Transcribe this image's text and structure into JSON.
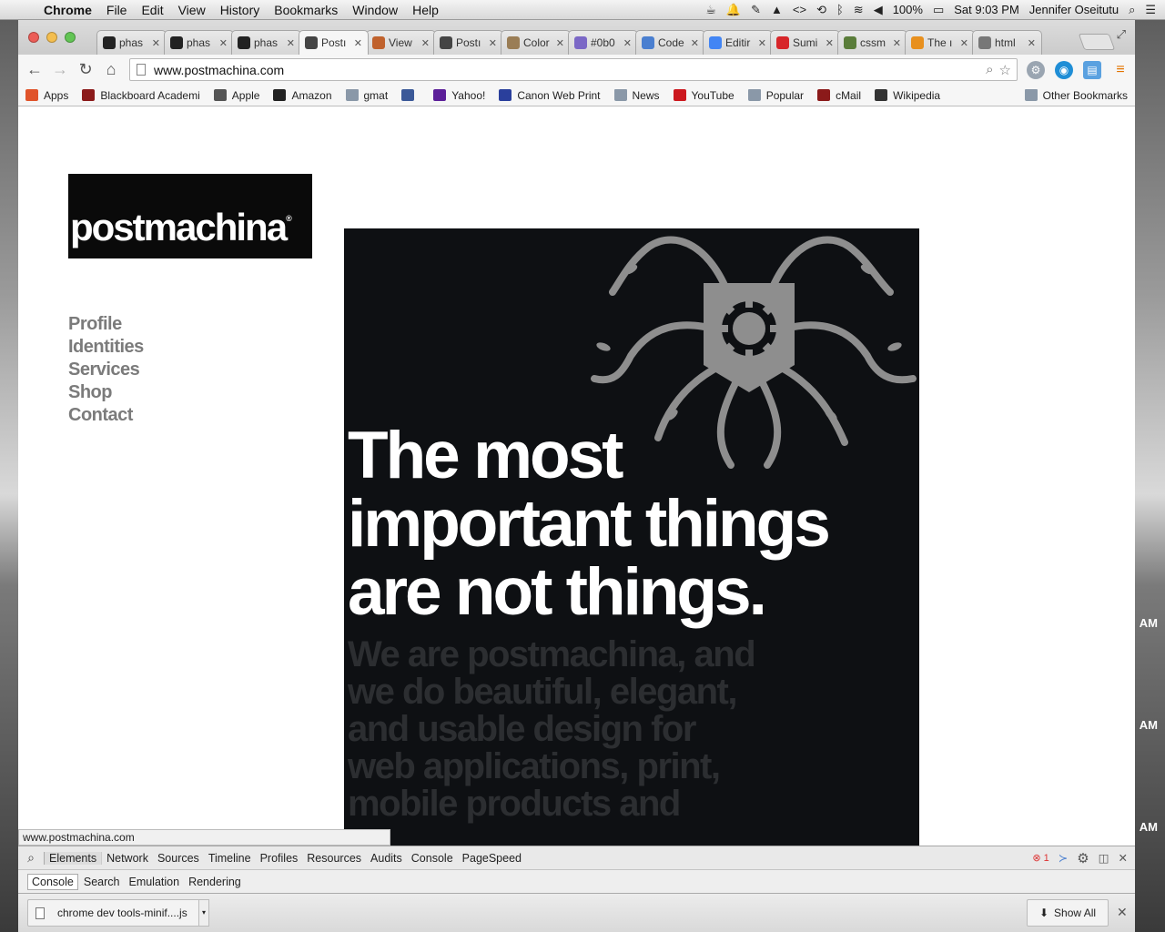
{
  "menubar": {
    "app": "Chrome",
    "items": [
      "File",
      "Edit",
      "View",
      "History",
      "Bookmarks",
      "Window",
      "Help"
    ],
    "battery": "100%",
    "clock": "Sat 9:03 PM",
    "user": "Jennifer Oseitutu"
  },
  "tabs": [
    {
      "title": "phas",
      "favicon": "github-icon",
      "color": "#222222"
    },
    {
      "title": "phas",
      "favicon": "github-icon",
      "color": "#222222"
    },
    {
      "title": "phas",
      "favicon": "github-icon",
      "color": "#222222"
    },
    {
      "title": "Postı",
      "favicon": "postmachina-icon",
      "color": "#444444",
      "active": true
    },
    {
      "title": "View",
      "favicon": "cube-icon",
      "color": "#c0622d"
    },
    {
      "title": "Postı",
      "favicon": "postmachina-icon",
      "color": "#444444"
    },
    {
      "title": "Color",
      "favicon": "palette-icon",
      "color": "#9a7d55"
    },
    {
      "title": "#0b0",
      "favicon": "color-wheel-icon",
      "color": "#7b68c6"
    },
    {
      "title": "Code",
      "favicon": "document-icon",
      "color": "#4a7fd0"
    },
    {
      "title": "Editir",
      "favicon": "google-icon",
      "color": "#4285f4"
    },
    {
      "title": "Sumi",
      "favicon": "sumi-icon",
      "color": "#d7262a"
    },
    {
      "title": "cssm",
      "favicon": "photo-icon",
      "color": "#5a7d3a"
    },
    {
      "title": "The ı",
      "favicon": "asterisk-icon",
      "color": "#e8901e"
    },
    {
      "title": "html",
      "favicon": "terminal-icon",
      "color": "#777777"
    }
  ],
  "toolbar": {
    "url": "www.postmachina.com"
  },
  "bookmarks": [
    {
      "label": "Apps",
      "icon": "apps-grid-icon",
      "color": "#e0532a"
    },
    {
      "label": "Blackboard Academi",
      "icon": "blackboard-icon",
      "color": "#8b1a1a"
    },
    {
      "label": "Apple",
      "icon": "apple-icon",
      "color": "#555555"
    },
    {
      "label": "Amazon",
      "icon": "amazon-icon",
      "color": "#222222"
    },
    {
      "label": "gmat",
      "icon": "folder-icon",
      "color": "#8a98a8"
    },
    {
      "label": "",
      "icon": "facebook-icon",
      "color": "#3b5998"
    },
    {
      "label": "Yahoo!",
      "icon": "yahoo-icon",
      "color": "#5c1f99"
    },
    {
      "label": "Canon Web Print",
      "icon": "canon-icon",
      "color": "#2a3f9c"
    },
    {
      "label": "News",
      "icon": "folder-icon",
      "color": "#8a98a8"
    },
    {
      "label": "YouTube",
      "icon": "youtube-icon",
      "color": "#cc181e"
    },
    {
      "label": "Popular",
      "icon": "folder-icon",
      "color": "#8a98a8"
    },
    {
      "label": "cMail",
      "icon": "cmail-icon",
      "color": "#8b1a1a"
    },
    {
      "label": "Wikipedia",
      "icon": "wikipedia-icon",
      "color": "#333333"
    }
  ],
  "other_bookmarks": "Other Bookmarks",
  "site": {
    "logo": "postmachina",
    "nav": [
      "Profile",
      "Identities",
      "Services",
      "Shop",
      "Contact"
    ],
    "headline": [
      "The most",
      "important things",
      "are not things."
    ],
    "tagline": "We are postmachina, and we do beautiful, elegant, and usable design for web applications, print, mobile products and"
  },
  "status_bubble": "www.postmachina.com",
  "devtools": {
    "tabs": [
      "Elements",
      "Network",
      "Sources",
      "Timeline",
      "Profiles",
      "Resources",
      "Audits",
      "Console",
      "PageSpeed"
    ],
    "active_tab": "Elements",
    "error_count": "1",
    "drawer_tabs": [
      "Console",
      "Search",
      "Emulation",
      "Rendering"
    ]
  },
  "downloads": {
    "file": "chrome dev tools-minif....js",
    "show_all": "Show All"
  },
  "desktop": {
    "am_labels": [
      "AM",
      "AM",
      "AM"
    ]
  },
  "colors": {
    "hero_bg": "#0e1013",
    "nav_text": "#7b7b7b",
    "octopus": "#8e8e8e"
  }
}
